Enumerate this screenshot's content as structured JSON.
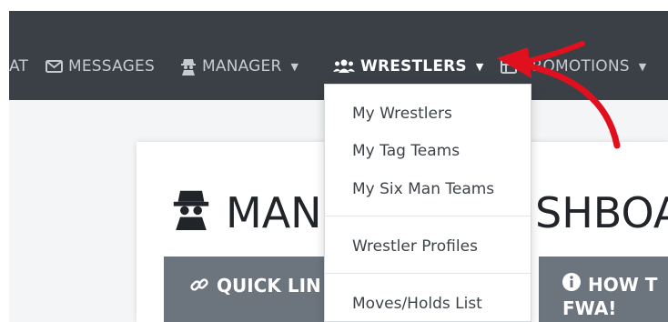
{
  "navbar": {
    "items": [
      {
        "label": "AT",
        "icon": "chat-icon"
      },
      {
        "label": "MESSAGES",
        "icon": "envelope-icon"
      },
      {
        "label": "MANAGER",
        "icon": "detective-icon"
      },
      {
        "label": "WRESTLERS",
        "icon": "users-icon"
      },
      {
        "label": "PROMOTIONS",
        "icon": "grid-icon"
      }
    ]
  },
  "dropdown": {
    "items": [
      "My Wrestlers",
      "My Tag Teams",
      "My Six Man Teams",
      "Wrestler Profiles",
      "Moves/Holds List"
    ]
  },
  "dashboard": {
    "title_left": "MAN",
    "title_right": "SHBOA",
    "quick_links": "QUICK LIN",
    "howto_line1": "HOW T",
    "howto_line2": "FWA!"
  },
  "colors": {
    "navbar_bg": "#3b4046",
    "button_bg": "#6c757d",
    "arrow": "#e0101e"
  }
}
